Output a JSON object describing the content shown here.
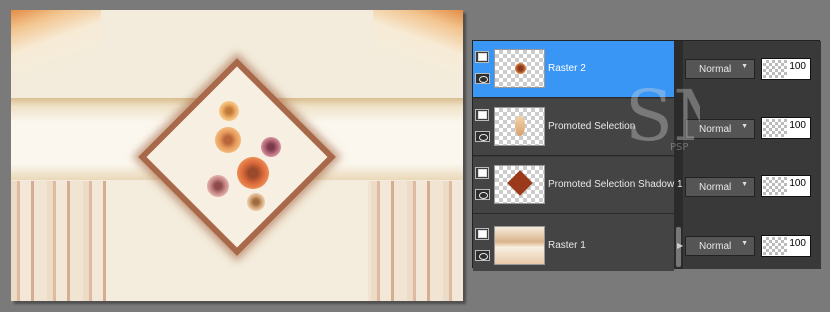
{
  "canvas": {
    "description_icon": "floral-artwork-canvas"
  },
  "layers": [
    {
      "name": "Raster 2",
      "blend_mode": "Normal",
      "opacity": "100",
      "selected": true,
      "thumb_icon": "small-flower-thumbnail"
    },
    {
      "name": "Promoted Selection",
      "blend_mode": "Normal",
      "opacity": "100",
      "selected": false,
      "thumb_icon": "vase-thumbnail"
    },
    {
      "name": "Promoted Selection Shadow 1",
      "blend_mode": "Normal",
      "opacity": "100",
      "selected": false,
      "thumb_icon": "diamond-shadow-thumbnail"
    },
    {
      "name": "Raster 1",
      "blend_mode": "Normal",
      "opacity": "100",
      "selected": false,
      "thumb_icon": "background-thumbnail"
    }
  ],
  "watermark": {
    "letters": "SM",
    "small_text": "PSP"
  },
  "colors": {
    "selected": "#3a96f5",
    "panel": "#444444",
    "background": "#7a7a7a"
  }
}
